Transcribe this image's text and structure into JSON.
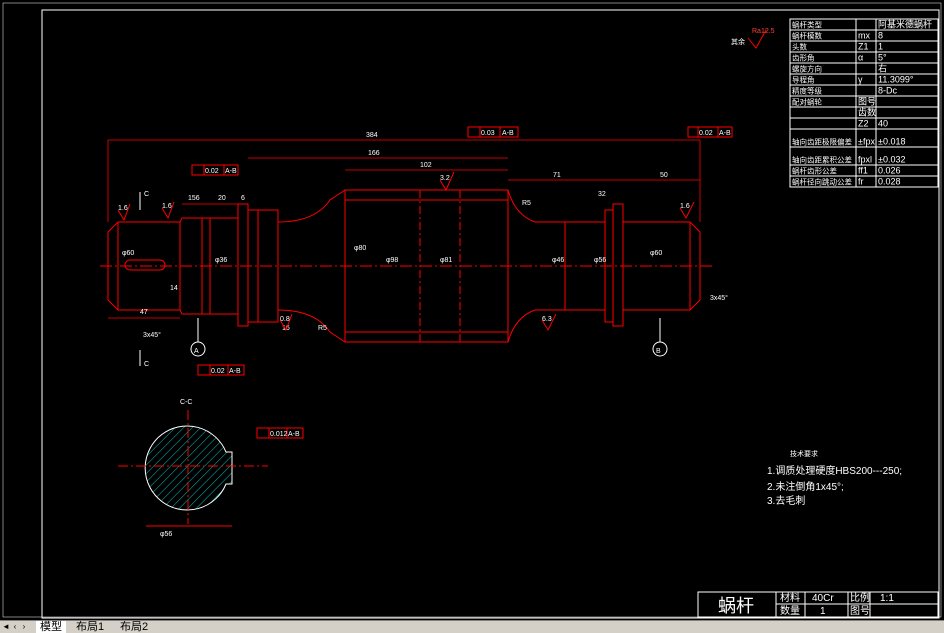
{
  "labels": {
    "ra_main": "Ra12.5",
    "remaining": "其余",
    "ra_16": "1.6",
    "ra_32": "3.2",
    "ra_08": "0.8",
    "ra_63": "6.3"
  },
  "param_table": [
    {
      "name": "蜗杆类型",
      "sym": "",
      "val": "阿基米德蜗杆"
    },
    {
      "name": "蜗杆模数",
      "sym": "mx",
      "val": "8"
    },
    {
      "name": "头数",
      "sym": "Z1",
      "val": "1"
    },
    {
      "name": "齿形角",
      "sym": "α",
      "val": "5°"
    },
    {
      "name": "螺旋方向",
      "sym": "",
      "val": "右"
    },
    {
      "name": "导程角",
      "sym": "γ",
      "val": "11.3099°"
    },
    {
      "name": "精度等级",
      "sym": "",
      "val": "8-Dc"
    },
    {
      "name": "配对蜗轮",
      "sym": "图号",
      "val": ""
    },
    {
      "name": "",
      "sym": "齿数",
      "val": ""
    },
    {
      "name": "",
      "sym": "Z2",
      "val": "40"
    },
    {
      "name": "轴向齿距极限偏差",
      "sym": "±fpx",
      "val": "±0.018"
    },
    {
      "name": "轴向齿距累积公差",
      "sym": "fpxl",
      "val": "±0.032"
    },
    {
      "name": "蜗杆齿形公差",
      "sym": "ff1",
      "val": "0.026"
    },
    {
      "name": "蜗杆径向跳动公差",
      "sym": "fr",
      "val": "0.028"
    }
  ],
  "dimensions": {
    "overall": "384",
    "d166": "166",
    "d102": "102",
    "d71": "71",
    "d50": "50",
    "d156": "156",
    "d20": "20",
    "d6": "6",
    "d47": "47",
    "chamfer_left": "3x45°",
    "chamfer_right": "3x45°",
    "r5": "R5",
    "r5b": "R5",
    "d14": "14",
    "d16": "16",
    "d32": "32",
    "d60a": "φ60",
    "d60b": "φ60",
    "d56": "φ56",
    "d46": "φ46",
    "d36": "φ36",
    "d80": "φ80",
    "d98": "φ98",
    "d81": "φ81",
    "section_dim": "φ56"
  },
  "gdt": {
    "top_runout": "0.03",
    "top_ref": "A-B",
    "right_runout": "0.02",
    "right_ref": "A-B",
    "left_runout": "0.02",
    "left_ref": "A-B",
    "bottom_parallel": "0.02",
    "bottom_ref": "A-B",
    "section_sym": "0.012",
    "section_ref": "A-B"
  },
  "datums": {
    "a": "A",
    "b": "B"
  },
  "section_label": "C-C",
  "section_marks": [
    "C",
    "C"
  ],
  "notes": {
    "title": "技术要求",
    "items": [
      "1.调质处理硬度HBS200---250;",
      "2.未注倒角1x45°;",
      "3.去毛刺"
    ]
  },
  "title_block": {
    "part_name": "蜗杆",
    "material_label": "材料",
    "material_value": "40Cr",
    "scale_label": "比例",
    "scale_value": "1:1",
    "qty_label": "数量",
    "qty_value": "1",
    "drawing_label": "图号",
    "drawing_value": ""
  },
  "tabs": [
    "模型",
    "布局1",
    "布局2"
  ],
  "colors": {
    "line": "#ff0000",
    "border": "#ffffff",
    "hatch": "#00c8c8",
    "text": "#ffffff",
    "bg": "#000000"
  }
}
